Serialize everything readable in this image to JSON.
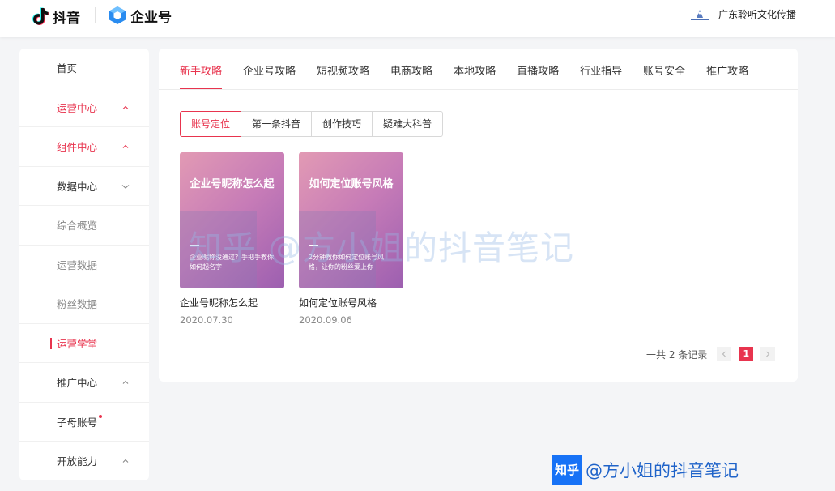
{
  "header": {
    "brand": "抖音",
    "product": "企业号",
    "user_name": "广东聆听文化传播"
  },
  "sidebar": {
    "items": [
      {
        "label": "首页",
        "style": "normal",
        "arrow": ""
      },
      {
        "label": "运营中心",
        "style": "red",
        "arrow": "up"
      },
      {
        "label": "组件中心",
        "style": "red",
        "arrow": "up"
      },
      {
        "label": "数据中心",
        "style": "normal",
        "arrow": "down"
      },
      {
        "label": "综合概览",
        "style": "sub",
        "arrow": ""
      },
      {
        "label": "运营数据",
        "style": "sub",
        "arrow": ""
      },
      {
        "label": "粉丝数据",
        "style": "sub",
        "arrow": ""
      },
      {
        "label": "运营学堂",
        "style": "active",
        "arrow": ""
      },
      {
        "label": "推广中心",
        "style": "normal",
        "arrow": "up"
      },
      {
        "label": "子母账号",
        "style": "normal",
        "arrow": "",
        "dot": true
      },
      {
        "label": "开放能力",
        "style": "normal",
        "arrow": "up"
      }
    ]
  },
  "tabs": [
    "新手攻略",
    "企业号攻略",
    "短视频攻略",
    "电商攻略",
    "本地攻略",
    "直播攻略",
    "行业指导",
    "账号安全",
    "推广攻略"
  ],
  "active_tab": 0,
  "segments": [
    "账号定位",
    "第一条抖音",
    "创作技巧",
    "疑难大科普"
  ],
  "active_segment": 0,
  "cards": [
    {
      "cover_title": "企业号昵称怎么起",
      "cover_desc": "企业昵称没通过？手把手教你如何起名字",
      "title": "企业号昵称怎么起",
      "date": "2020.07.30"
    },
    {
      "cover_title": "如何定位账号风格",
      "cover_desc": "2分钟教你如何定位账号风格，让你的粉丝爱上你",
      "title": "如何定位账号风格",
      "date": "2020.09.06"
    }
  ],
  "pagination": {
    "total_label": "一共 2 条记录",
    "current": "1"
  },
  "watermark": {
    "text": "知乎 @方小姐的抖音笔记",
    "logo": "知乎",
    "handle": "@方小姐的抖音笔记"
  },
  "colors": {
    "accent": "#e8344e",
    "zhihu_blue": "#1772f6"
  }
}
